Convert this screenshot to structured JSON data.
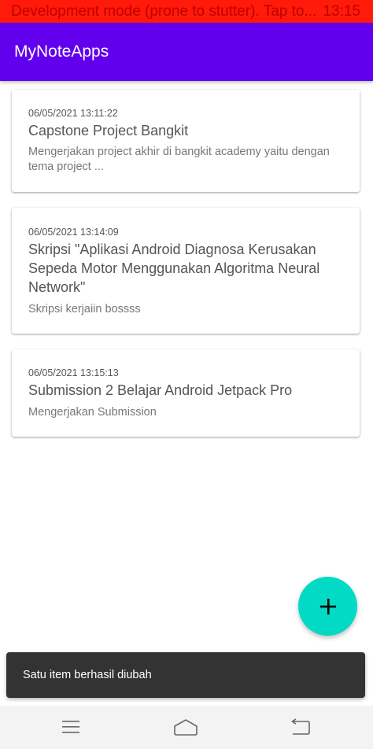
{
  "dev_banner": {
    "message": "Development mode (prone to stutter). Tap to...",
    "time": "13:15"
  },
  "appbar": {
    "title": "MyNoteApps"
  },
  "notes": [
    {
      "date": "06/05/2021 13:11:22",
      "title": "Capstone Project Bangkit",
      "description": "Mengerjakan project akhir di bangkit academy yaitu dengan tema project ..."
    },
    {
      "date": "06/05/2021 13:14:09",
      "title": "Skripsi \"Aplikasi Android Diagnosa Kerusakan Sepeda Motor Menggunakan Algoritma Neural Network\"",
      "description": "Skripsi kerjaiin bossss"
    },
    {
      "date": "06/05/2021 13:15:13",
      "title": "Submission 2 Belajar Android Jetpack Pro",
      "description": "Mengerjakan Submission"
    }
  ],
  "fab": {
    "icon": "plus-icon"
  },
  "snackbar": {
    "message": "Satu item berhasil diubah"
  },
  "navigation_bar": {
    "icons": [
      "menu-icon",
      "home-icon",
      "back-icon"
    ]
  },
  "colors": {
    "primary": "#6200ee",
    "accent": "#03dac5",
    "dev_banner": "#ff1a0a",
    "snackbar": "#333333"
  }
}
